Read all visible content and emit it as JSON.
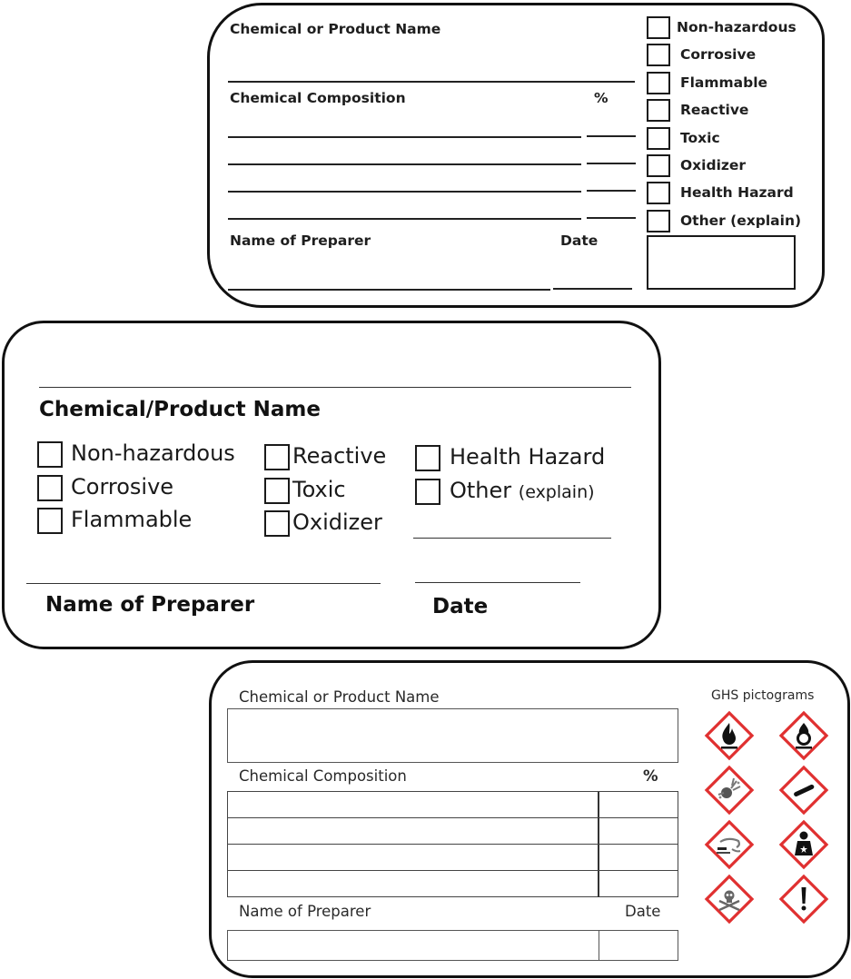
{
  "label_1": {
    "product_name_label": "Chemical or Product Name",
    "composition_label": "Chemical Composition",
    "percent_label": "%",
    "preparer_label": "Name of Preparer",
    "date_label": "Date",
    "hazards": [
      {
        "label": "Non-hazardous",
        "checked": false
      },
      {
        "label": "Corrosive",
        "checked": false
      },
      {
        "label": "Flammable",
        "checked": false
      },
      {
        "label": "Reactive",
        "checked": false
      },
      {
        "label": "Toxic",
        "checked": false
      },
      {
        "label": "Oxidizer",
        "checked": false
      },
      {
        "label": "Health Hazard",
        "checked": false
      },
      {
        "label": "Other (explain)",
        "checked": false
      }
    ]
  },
  "label_2": {
    "product_name_label": "Chemical/Product Name",
    "hazards": [
      {
        "label": "Non-hazardous",
        "checked": false
      },
      {
        "label": "Corrosive",
        "checked": false
      },
      {
        "label": "Flammable",
        "checked": false
      },
      {
        "label": "Reactive",
        "checked": false
      },
      {
        "label": "Toxic",
        "checked": false
      },
      {
        "label": "Oxidizer",
        "checked": false
      },
      {
        "label": "Health Hazard",
        "checked": false
      },
      {
        "label": "Other",
        "checked": false
      }
    ],
    "other_suffix": "(explain)",
    "preparer_label": "Name of Preparer",
    "date_label": "Date"
  },
  "label_3": {
    "product_name_label": "Chemical or Product Name",
    "composition_label": "Chemical Composition",
    "percent_label": "%",
    "preparer_label": "Name of Preparer",
    "date_label": "Date",
    "ghs_title": "GHS pictograms",
    "pictograms": [
      "flame-icon",
      "flame-over-circle-icon",
      "exploding-bomb-icon",
      "gas-cylinder-icon",
      "corrosion-icon",
      "health-hazard-icon",
      "skull-crossbones-icon",
      "exclamation-mark-icon"
    ],
    "colors": {
      "pictogram_border": "#e03030"
    }
  }
}
